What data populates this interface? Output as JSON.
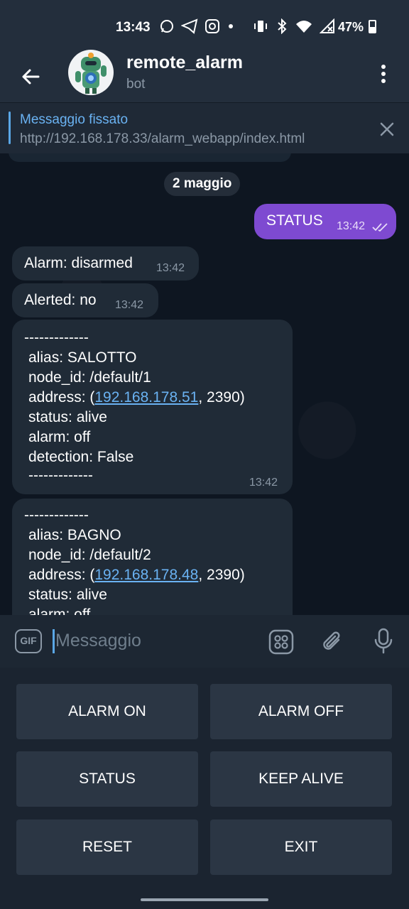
{
  "status_bar": {
    "time": "13:43",
    "battery": "47%"
  },
  "header": {
    "title": "remote_alarm",
    "subtitle": "bot"
  },
  "pinned": {
    "title": "Messaggio fissato",
    "text": "http://192.168.178.33/alarm_webapp/index.html"
  },
  "chat": {
    "date": "2 maggio",
    "messages": [
      {
        "text": "STATUS",
        "time": "13:42"
      },
      {
        "text": "Alarm: disarmed",
        "time": "13:42"
      },
      {
        "text": "Alerted: no",
        "time": "13:42"
      }
    ],
    "node1": {
      "sep": "-------------",
      "alias": "alias: SALOTTO",
      "node_id": "node_id: /default/1",
      "addr_prefix": "address: (",
      "addr_ip": "192.168.178.51",
      "addr_suffix": ", 2390)",
      "status": "status: alive",
      "alarm": "alarm: off",
      "detection": "detection: False",
      "sep_end": "-------------",
      "time": "13:42"
    },
    "node2": {
      "sep": "-------------",
      "alias": "alias: BAGNO",
      "node_id": "node_id: /default/2",
      "addr_prefix": "address: (",
      "addr_ip": "192.168.178.48",
      "addr_suffix": ", 2390)",
      "status": "status: alive",
      "alarm": "alarm: off"
    }
  },
  "input": {
    "placeholder": "Messaggio",
    "gif_label": "GIF"
  },
  "keyboard": {
    "buttons": [
      "ALARM ON",
      "ALARM OFF",
      "STATUS",
      "KEEP ALIVE",
      "RESET",
      "EXIT"
    ]
  },
  "colors": {
    "accent": "#6ab2f2",
    "outgoing": "#7e4ad1",
    "bubble": "#202b37"
  },
  "icons": [
    "whatsapp-icon",
    "telegram-icon",
    "instagram-icon",
    "vibrate-icon",
    "bluetooth-icon",
    "wifi-icon",
    "no-signal-icon",
    "battery-icon",
    "back-arrow-icon",
    "more-vert-icon",
    "close-icon",
    "gif-icon",
    "keyboard-grid-icon",
    "paperclip-icon",
    "mic-icon",
    "double-check-icon"
  ]
}
